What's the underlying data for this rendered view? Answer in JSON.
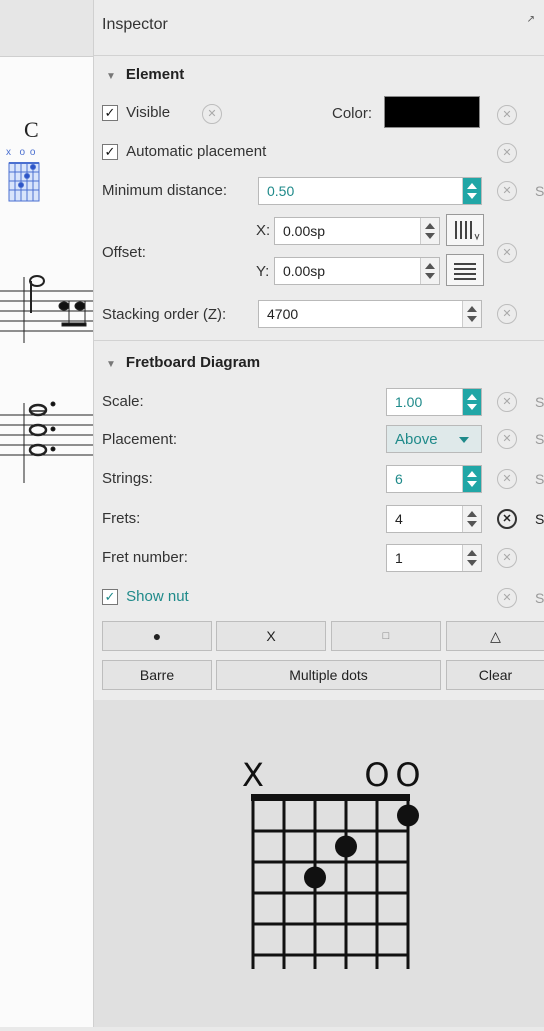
{
  "score": {
    "chord_symbol": "C",
    "mini_markers": "x  o o"
  },
  "inspector": {
    "title": "Inspector",
    "element_section": {
      "header": "Element",
      "visible_label": "Visible",
      "visible_checked": true,
      "color_label": "Color:",
      "color_value": "#000000",
      "auto_placement_label": "Automatic placement",
      "min_distance_label": "Minimum distance:",
      "min_distance_value": "0.50",
      "offset_label": "Offset:",
      "offset_x_label": "X:",
      "offset_x_value": "0.00sp",
      "offset_y_label": "Y:",
      "offset_y_value": "0.00sp",
      "stacking_label": "Stacking order (Z):",
      "stacking_value": "4700",
      "style_suffix": "S"
    },
    "fretboard_section": {
      "header": "Fretboard Diagram",
      "scale_label": "Scale:",
      "scale_value": "1.00",
      "placement_label": "Placement:",
      "placement_value": "Above",
      "strings_label": "Strings:",
      "strings_value": "6",
      "frets_label": "Frets:",
      "frets_value": "4",
      "fret_number_label": "Fret number:",
      "fret_number_value": "1",
      "show_nut_label": "Show nut",
      "show_nut_checked": true,
      "buttons_row1": [
        "●",
        "X",
        "□",
        "△"
      ],
      "buttons_row2": {
        "barre": "Barre",
        "multiple_dots": "Multiple dots",
        "clear": "Clear"
      }
    },
    "diagram": {
      "markers": [
        "X",
        "",
        "",
        "",
        "O",
        "O"
      ],
      "strings": 6,
      "frets": 5,
      "dots": [
        {
          "string": 2,
          "fret": 3
        },
        {
          "string": 3,
          "fret": 2
        },
        {
          "string": 5,
          "fret": 1
        }
      ]
    }
  }
}
